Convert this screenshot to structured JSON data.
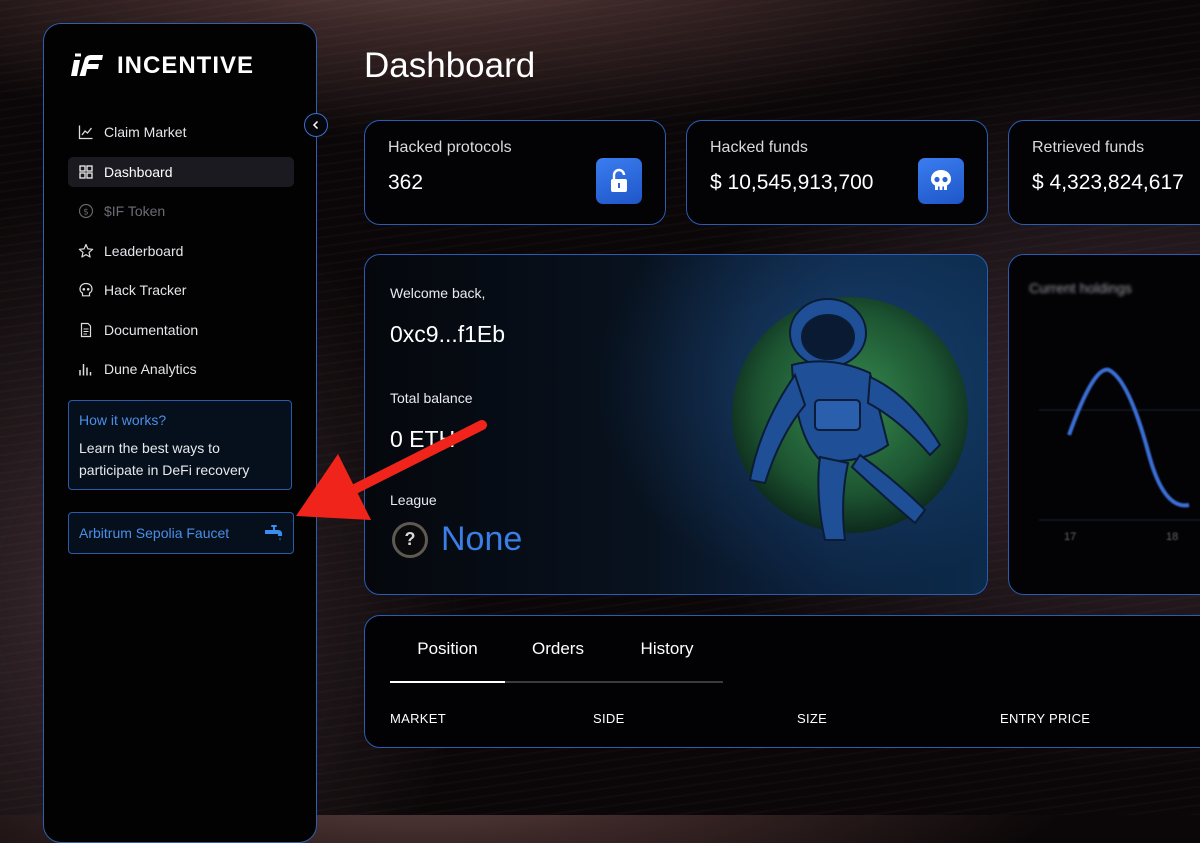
{
  "app": {
    "name": "INCENTIVE"
  },
  "sidebar": {
    "items": [
      {
        "label": "Claim Market",
        "icon": "chart-line-icon",
        "state": "normal"
      },
      {
        "label": "Dashboard",
        "icon": "grid-icon",
        "state": "active"
      },
      {
        "label": "$IF Token",
        "icon": "dollar-circle-icon",
        "state": "disabled"
      },
      {
        "label": "Leaderboard",
        "icon": "star-icon",
        "state": "normal"
      },
      {
        "label": "Hack Tracker",
        "icon": "skull-icon",
        "state": "normal"
      },
      {
        "label": "Documentation",
        "icon": "document-icon",
        "state": "normal"
      },
      {
        "label": "Dune Analytics",
        "icon": "bar-chart-icon",
        "state": "normal"
      }
    ],
    "how_it_works": {
      "title": "How it works?",
      "body": "Learn the best ways to participate in DeFi recovery"
    },
    "faucet": {
      "label": "Arbitrum Sepolia Faucet",
      "icon": "faucet-icon"
    }
  },
  "page": {
    "title": "Dashboard"
  },
  "stats": [
    {
      "label": "Hacked protocols",
      "value": "362",
      "icon": "unlock-icon"
    },
    {
      "label": "Hacked funds",
      "value": "$ 10,545,913,700",
      "icon": "skull-icon"
    },
    {
      "label": "Retrieved funds",
      "value": "$ 4,323,824,617"
    }
  ],
  "welcome": {
    "greeting": "Welcome back,",
    "address": "0xc9...f1Eb",
    "balance_label": "Total balance",
    "balance_value": "0 ETH",
    "league_label": "League",
    "league_badge": "?",
    "league_value": "None"
  },
  "holdings": {
    "title": "Current holdings",
    "x_ticks": [
      "17",
      "18"
    ]
  },
  "tabs": [
    {
      "label": "Position",
      "active": true
    },
    {
      "label": "Orders",
      "active": false
    },
    {
      "label": "History",
      "active": false
    }
  ],
  "table": {
    "columns": [
      "MARKET",
      "SIDE",
      "SIZE",
      "ENTRY PRICE"
    ]
  },
  "colors": {
    "accent_blue": "#3a7ee6",
    "border_blue": "#2b5cb3",
    "annotation_red": "#f0241a"
  }
}
